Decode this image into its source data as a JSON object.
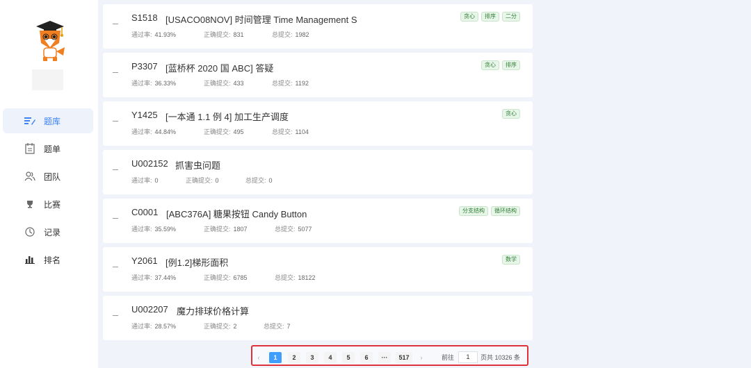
{
  "nav": {
    "items": [
      {
        "label": "题库",
        "icon": "edit-list-icon"
      },
      {
        "label": "题单",
        "icon": "calendar-list-icon"
      },
      {
        "label": "团队",
        "icon": "users-icon"
      },
      {
        "label": "比赛",
        "icon": "trophy-icon"
      },
      {
        "label": "记录",
        "icon": "clock-icon"
      },
      {
        "label": "排名",
        "icon": "bar-chart-icon"
      }
    ]
  },
  "problems": [
    {
      "id": "S1518",
      "title": "[USACO08NOV] 时间管理 Time Management S",
      "pass_label": "通过率:",
      "pass_rate": "41.93%",
      "ac_label": "正确提交:",
      "ac": "831",
      "total_label": "总提交:",
      "total": "1982",
      "tags": [
        "贪心",
        "排序",
        "二分"
      ]
    },
    {
      "id": "P3307",
      "title": "[蓝桥杯 2020 国 ABC] 答疑",
      "pass_label": "通过率:",
      "pass_rate": "36.33%",
      "ac_label": "正确提交:",
      "ac": "433",
      "total_label": "总提交:",
      "total": "1192",
      "tags": [
        "贪心",
        "排序"
      ]
    },
    {
      "id": "Y1425",
      "title": "[一本通 1.1 例 4] 加工生产调度",
      "pass_label": "通过率:",
      "pass_rate": "44.84%",
      "ac_label": "正确提交:",
      "ac": "495",
      "total_label": "总提交:",
      "total": "1104",
      "tags": [
        "贪心"
      ]
    },
    {
      "id": "U002152",
      "title": "抓害虫问题",
      "pass_label": "通过率:",
      "pass_rate": "0",
      "ac_label": "正确提交:",
      "ac": "0",
      "total_label": "总提交:",
      "total": "0",
      "tags": []
    },
    {
      "id": "C0001",
      "title": "[ABC376A] 糖果按钮 Candy Button",
      "pass_label": "通过率:",
      "pass_rate": "35.59%",
      "ac_label": "正确提交:",
      "ac": "1807",
      "total_label": "总提交:",
      "total": "5077",
      "tags": [
        "分支结构",
        "循环结构"
      ]
    },
    {
      "id": "Y2061",
      "title": "[例1.2]梯形面积",
      "pass_label": "通过率:",
      "pass_rate": "37.44%",
      "ac_label": "正确提交:",
      "ac": "6785",
      "total_label": "总提交:",
      "total": "18122",
      "tags": [
        "数学"
      ]
    },
    {
      "id": "U002207",
      "title": "魔力排球价格计算",
      "pass_label": "通过率:",
      "pass_rate": "28.57%",
      "ac_label": "正确提交:",
      "ac": "2",
      "total_label": "总提交:",
      "total": "7",
      "tags": []
    }
  ],
  "pagination": {
    "prev": "‹",
    "pages": [
      "1",
      "2",
      "3",
      "4",
      "5",
      "6"
    ],
    "ellipsis": "···",
    "last": "517",
    "next": "›",
    "current_page": "1",
    "goto_label": "前往",
    "goto_value": "1",
    "total_text": "页共 10326 条"
  },
  "colors": {
    "accent": "#409eff",
    "active_nav_text": "#3b82f6",
    "highlight_border": "#e0303a",
    "tag_text": "#2e7d32"
  }
}
